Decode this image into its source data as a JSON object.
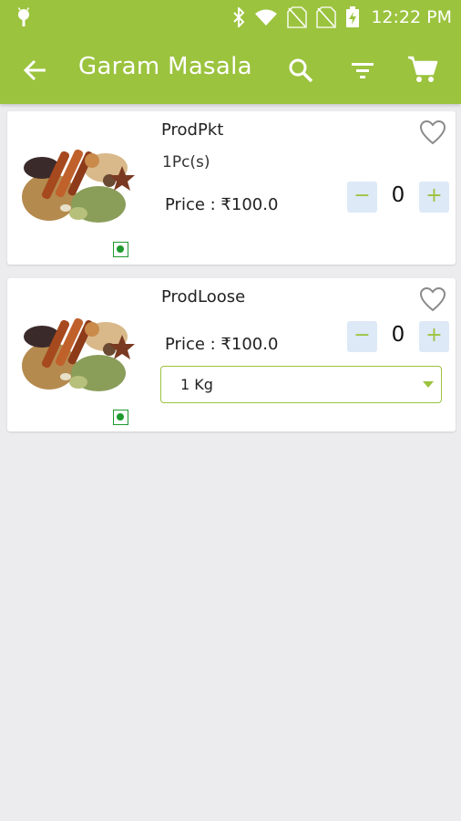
{
  "status_bar": {
    "time": "12:22 PM"
  },
  "app_bar": {
    "title": "Garam Masala"
  },
  "products": [
    {
      "name": "ProdPkt",
      "pack_size": "1Pc(s)",
      "price": "Price : ₹100.0",
      "quantity": "0",
      "minus": "−",
      "plus": "+"
    },
    {
      "name": "ProdLoose",
      "price": "Price : ₹100.0",
      "quantity": "0",
      "minus": "−",
      "plus": "+",
      "unit_selected": "1 Kg"
    }
  ],
  "colors": {
    "primary": "#9bc33e",
    "veg_green": "#1e9a2e",
    "qty_button_bg": "#dde9f6",
    "background": "#ececee"
  },
  "icons": [
    "android-icon",
    "bluetooth-icon",
    "wifi-icon",
    "no-sim-icon",
    "battery-charging-icon",
    "back-arrow-icon",
    "search-icon",
    "filter-icon",
    "cart-icon",
    "heart-outline-icon",
    "veg-indicator-icon",
    "dropdown-caret-icon"
  ]
}
